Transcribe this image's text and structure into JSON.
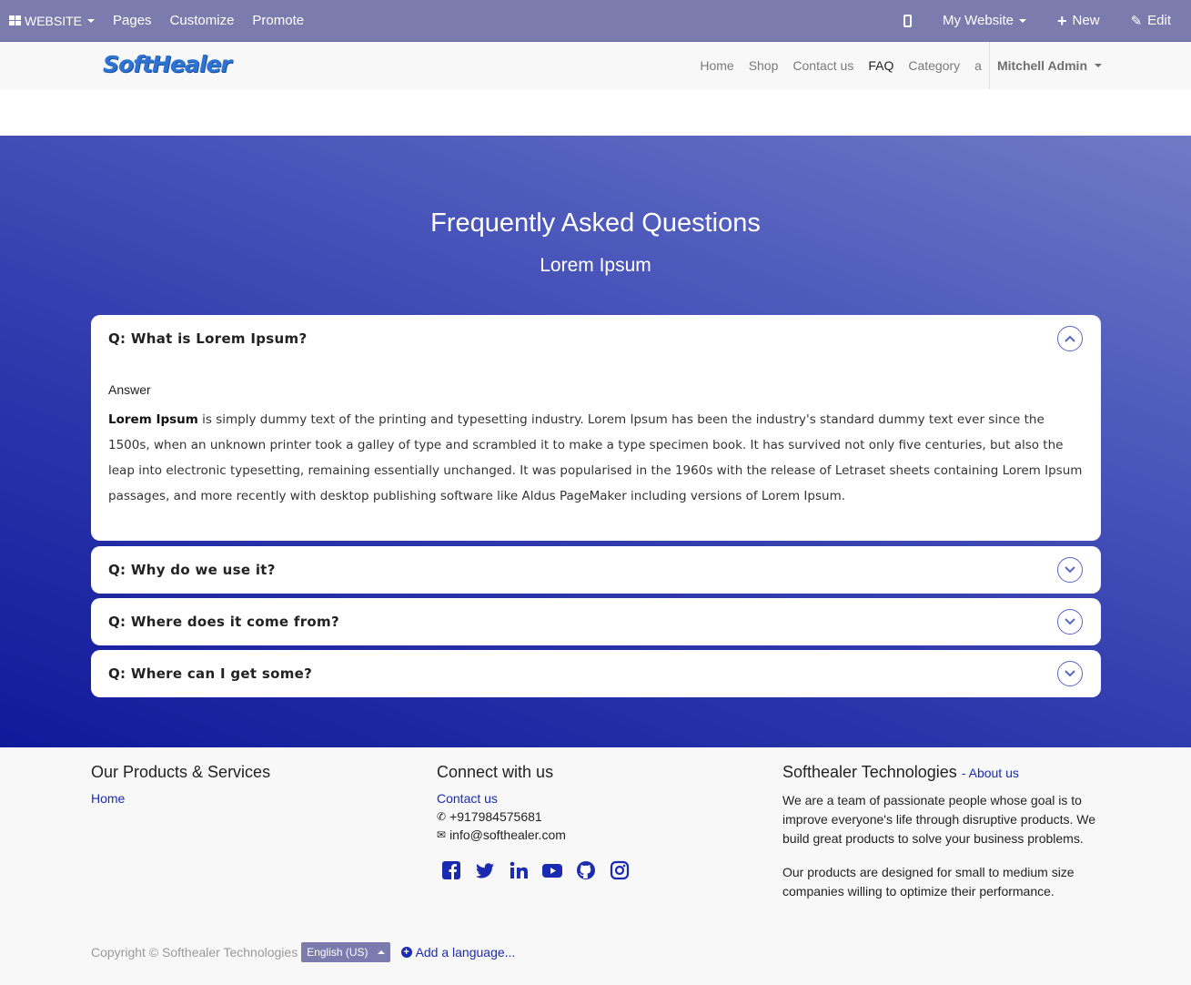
{
  "adminbar": {
    "website_label": "WEBSITE",
    "pages_label": "Pages",
    "customize_label": "Customize",
    "promote_label": "Promote",
    "my_website_label": "My Website",
    "new_label": "New",
    "edit_label": "Edit"
  },
  "header": {
    "logo_text": "SoftHealer",
    "nav": [
      "Home",
      "Shop",
      "Contact us",
      "FAQ",
      "Category",
      "a"
    ],
    "active_nav": "FAQ",
    "user_label": "Mitchell Admin"
  },
  "hero": {
    "title": "Frequently Asked Questions",
    "subtitle": "Lorem Ipsum"
  },
  "faq": [
    {
      "question": "Q: What is Lorem Ipsum?",
      "expanded": true,
      "answer_label": "Answer",
      "answer_bold": "Lorem Ipsum",
      "answer_text": " is simply dummy text of the printing and typesetting industry. Lorem Ipsum has been the industry's standard dummy text ever since the 1500s, when an unknown printer took a galley of type and scrambled it to make a type specimen book. It has survived not only five centuries, but also the leap into electronic typesetting, remaining essentially unchanged. It was popularised in the 1960s with the release of Letraset sheets containing Lorem Ipsum passages, and more recently with desktop publishing software like Aldus PageMaker including versions of Lorem Ipsum."
    },
    {
      "question": "Q: Why do we use it?",
      "expanded": false
    },
    {
      "question": "Q: Where does it come from?",
      "expanded": false
    },
    {
      "question": "Q: Where can I get some?",
      "expanded": false
    }
  ],
  "footer": {
    "products_title": "Our Products & Services",
    "products_home": "Home",
    "connect_title": "Connect with us",
    "contact_link": "Contact us",
    "phone": "+917984575681",
    "email": "info@softhealer.com",
    "about_title": "Softhealer Technologies",
    "about_link": "- About us",
    "about_p1": "We are a team of passionate people whose goal is to improve everyone's life through disruptive products. We build great products to solve your business problems.",
    "about_p2": "Our products are designed for small to medium size companies willing to optimize their performance.",
    "social_icons": [
      "facebook-icon",
      "twitter-icon",
      "linkedin-icon",
      "youtube-icon",
      "github-icon",
      "instagram-icon"
    ],
    "copyright": "Copyright © Softhealer Technologies",
    "language": "English (US)",
    "add_language": "Add a language..."
  },
  "colors": {
    "adminbar": "#7c7bad",
    "link": "#1a2bb0",
    "hero_top": "#6f7bc4",
    "hero_bottom": "#11199a"
  }
}
